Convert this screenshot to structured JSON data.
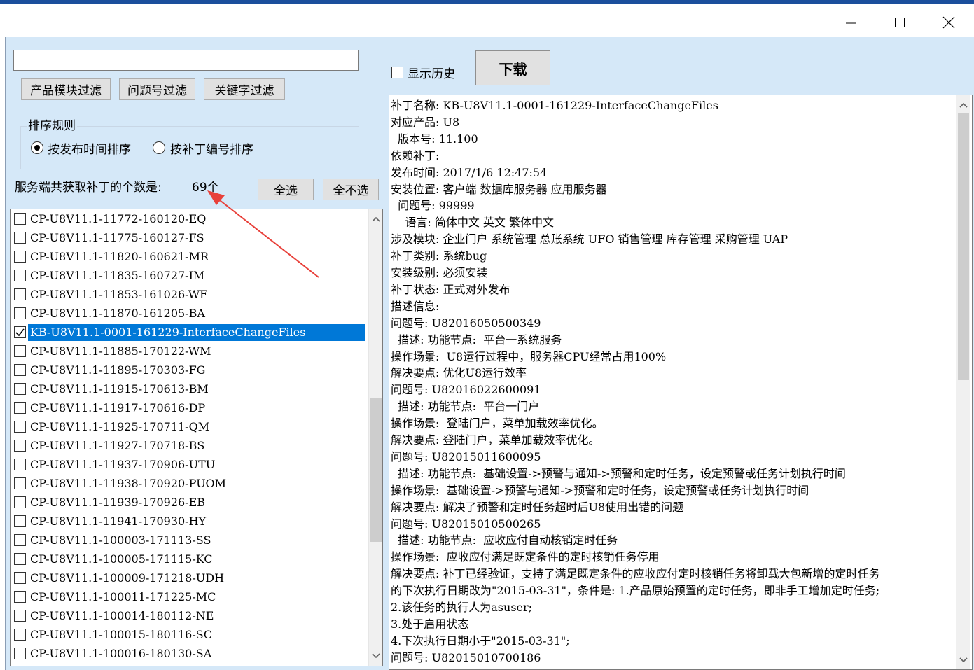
{
  "filter": {
    "search_value": "",
    "buttons": {
      "product_module": "产品模块过滤",
      "issue_number": "问题号过滤",
      "keyword": "关键字过滤"
    }
  },
  "sort": {
    "label": "排序规则",
    "by_time": "按发布时间排序",
    "by_number": "按补丁编号排序",
    "selected": "by_time"
  },
  "count": {
    "label": "服务端共获取补丁的个数是:",
    "value": "69个"
  },
  "selection": {
    "select_all": "全选",
    "select_none": "全不选"
  },
  "history": {
    "label": "显示历史",
    "checked": false
  },
  "download_label": "下载",
  "patches": [
    {
      "id": "CP-U8V11.1-11772-160120-EQ",
      "checked": false,
      "selected": false
    },
    {
      "id": "CP-U8V11.1-11775-160127-FS",
      "checked": false,
      "selected": false
    },
    {
      "id": "CP-U8V11.1-11820-160621-MR",
      "checked": false,
      "selected": false
    },
    {
      "id": "CP-U8V11.1-11835-160727-IM",
      "checked": false,
      "selected": false
    },
    {
      "id": "CP-U8V11.1-11853-161026-WF",
      "checked": false,
      "selected": false
    },
    {
      "id": "CP-U8V11.1-11870-161205-BA",
      "checked": false,
      "selected": false
    },
    {
      "id": "KB-U8V11.1-0001-161229-InterfaceChangeFiles",
      "checked": true,
      "selected": true
    },
    {
      "id": "CP-U8V11.1-11885-170122-WM",
      "checked": false,
      "selected": false
    },
    {
      "id": "CP-U8V11.1-11895-170303-FG",
      "checked": false,
      "selected": false
    },
    {
      "id": "CP-U8V11.1-11915-170613-BM",
      "checked": false,
      "selected": false
    },
    {
      "id": "CP-U8V11.1-11917-170616-DP",
      "checked": false,
      "selected": false
    },
    {
      "id": "CP-U8V11.1-11925-170711-QM",
      "checked": false,
      "selected": false
    },
    {
      "id": "CP-U8V11.1-11927-170718-BS",
      "checked": false,
      "selected": false
    },
    {
      "id": "CP-U8V11.1-11937-170906-UTU",
      "checked": false,
      "selected": false
    },
    {
      "id": "CP-U8V11.1-11938-170920-PUOM",
      "checked": false,
      "selected": false
    },
    {
      "id": "CP-U8V11.1-11939-170926-EB",
      "checked": false,
      "selected": false
    },
    {
      "id": "CP-U8V11.1-11941-170930-HY",
      "checked": false,
      "selected": false
    },
    {
      "id": "CP-U8V11.1-100003-171113-SS",
      "checked": false,
      "selected": false
    },
    {
      "id": "CP-U8V11.1-100005-171115-KC",
      "checked": false,
      "selected": false
    },
    {
      "id": "CP-U8V11.1-100009-171218-UDH",
      "checked": false,
      "selected": false
    },
    {
      "id": "CP-U8V11.1-100011-171225-MC",
      "checked": false,
      "selected": false
    },
    {
      "id": "CP-U8V11.1-100014-180112-NE",
      "checked": false,
      "selected": false
    },
    {
      "id": "CP-U8V11.1-100015-180116-SC",
      "checked": false,
      "selected": false
    },
    {
      "id": "CP-U8V11.1-100016-180130-SA",
      "checked": false,
      "selected": false
    }
  ],
  "details": [
    "补丁名称: KB-U8V11.1-0001-161229-InterfaceChangeFiles",
    "对应产品: U8",
    "  版本号: 11.100",
    "依赖补丁:",
    "发布时间: 2017/1/6 12:47:54",
    "安装位置: 客户端 数据库服务器 应用服务器",
    "  问题号: 99999",
    "    语言: 简体中文 英文 繁体中文",
    "涉及模块: 企业门户 系统管理 总账系统 UFO 销售管理 库存管理 采购管理 UAP",
    "补丁类别: 系统bug",
    "安装级别: 必须安装",
    "补丁状态: 正式对外发布",
    "描述信息:",
    "问题号: U82016050500349",
    "  描述: 功能节点:  平台一系统服务",
    "操作场景:  U8运行过程中，服务器CPU经常占用100%",
    "解决要点: 优化U8运行效率",
    "问题号: U82016022600091",
    "  描述: 功能节点:  平台一门户",
    "操作场景:  登陆门户，菜单加载效率优化。",
    "解决要点: 登陆门户，菜单加载效率优化。",
    "问题号: U82015011600095",
    "  描述: 功能节点:  基础设置->预警与通知->预警和定时任务，设定预警或任务计划执行时间",
    "操作场景:  基础设置->预警与通知->预警和定时任务，设定预警或任务计划执行时间",
    "解决要点: 解决了预警和定时任务超时后U8使用出错的问题",
    "问题号: U82015010500265",
    "  描述: 功能节点:  应收应付自动核销定时任务",
    "操作场景:  应收应付满足既定条件的定时核销任务停用",
    "解决要点: 补丁已经验证，支持了满足既定条件的应收应付定时核销任务将卸载大包新增的定时任务",
    "的下次执行日期改为\"2015-03-31\"，条件是: 1.产品原始预置的定时任务，即非手工增加定时任务;",
    "2.该任务的执行人为asuser;",
    "3.处于启用状态",
    "4.下次执行日期小于\"2015-03-31\";",
    "问题号: U82015010700186"
  ],
  "colors": {
    "title_accent": "#1b4f9c",
    "client_background": "#d5e8f8",
    "selection": "#0078d7",
    "annotation_arrow": "#e8403a"
  }
}
